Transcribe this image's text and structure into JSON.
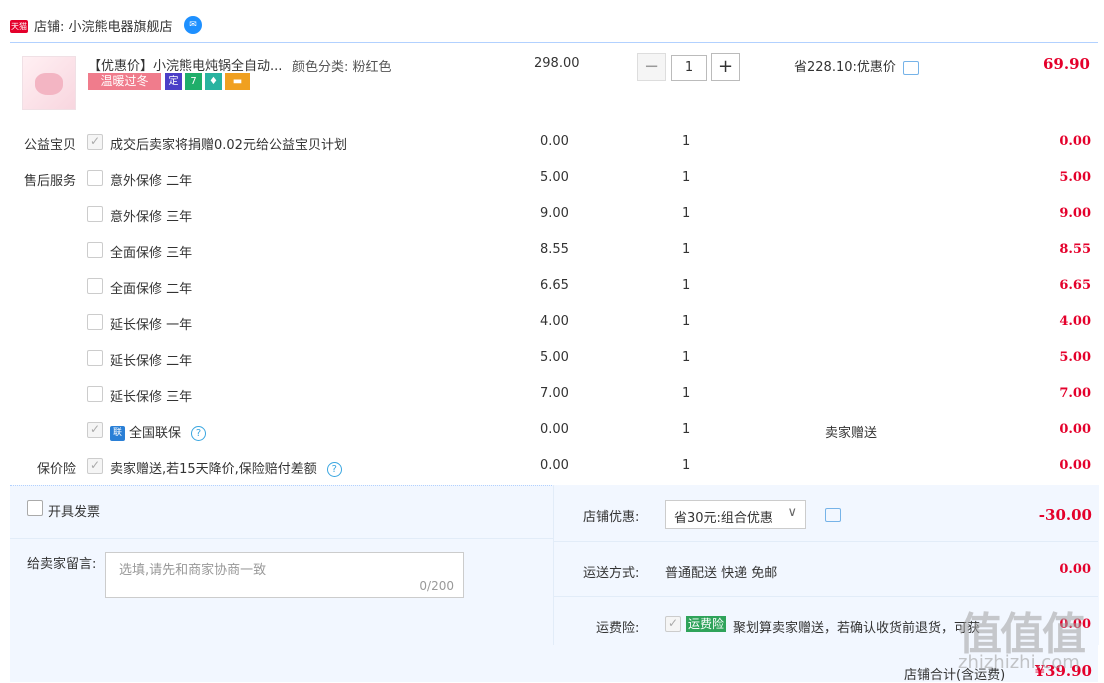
{
  "shop": {
    "badge": "天猫",
    "name": "店铺: 小浣熊电器旗舰店"
  },
  "item": {
    "title": "【优惠价】小浣熊电炖锅全自动...",
    "sku": "颜色分类: 粉红色",
    "badge_warm": "温暖过冬",
    "icons": [
      "定",
      "7",
      "♦",
      "▬"
    ],
    "unit_price": "298.00",
    "quantity": "1",
    "promo": "省228.10:优惠价",
    "total": "69.90"
  },
  "services": [
    {
      "label": "公益宝贝",
      "checked": true,
      "name": "成交后卖家将捐赠0.02元给公益宝贝计划",
      "price": "0.00",
      "qty": "1",
      "note": "",
      "total": "0.00"
    },
    {
      "label": "售后服务",
      "checked": false,
      "name": "意外保修 二年",
      "price": "5.00",
      "qty": "1",
      "note": "",
      "total": "5.00"
    },
    {
      "label": "",
      "checked": false,
      "name": "意外保修 三年",
      "price": "9.00",
      "qty": "1",
      "note": "",
      "total": "9.00"
    },
    {
      "label": "",
      "checked": false,
      "name": "全面保修 三年",
      "price": "8.55",
      "qty": "1",
      "note": "",
      "total": "8.55"
    },
    {
      "label": "",
      "checked": false,
      "name": "全面保修 二年",
      "price": "6.65",
      "qty": "1",
      "note": "",
      "total": "6.65"
    },
    {
      "label": "",
      "checked": false,
      "name": "延长保修 一年",
      "price": "4.00",
      "qty": "1",
      "note": "",
      "total": "4.00"
    },
    {
      "label": "",
      "checked": false,
      "name": "延长保修 二年",
      "price": "5.00",
      "qty": "1",
      "note": "",
      "total": "5.00"
    },
    {
      "label": "",
      "checked": false,
      "name": "延长保修 三年",
      "price": "7.00",
      "qty": "1",
      "note": "",
      "total": "7.00"
    },
    {
      "label": "",
      "checked": true,
      "name": "全国联保",
      "price": "0.00",
      "qty": "1",
      "note": "卖家赠送",
      "total": "0.00"
    },
    {
      "label": "保价险",
      "checked": true,
      "name": "卖家赠送,若15天降价,保险赔付差额",
      "price": "0.00",
      "qty": "1",
      "note": "",
      "total": "0.00"
    }
  ],
  "lian_badge": "联",
  "invoice": {
    "label": "开具发票"
  },
  "message": {
    "label": "给卖家留言:",
    "placeholder": "选填,请先和商家协商一致",
    "count": "0/200"
  },
  "discount": {
    "label": "店铺优惠:",
    "selected": "省30元:组合优惠",
    "total": "-30.00"
  },
  "shipping": {
    "label": "运送方式:",
    "value": "普通配送 快递 免邮",
    "total": "0.00"
  },
  "insurance": {
    "label": "运费险:",
    "tag": "运费险",
    "text": "聚划算卖家赠送，若确认收货前退货，可获",
    "total": "0.00"
  },
  "summary": {
    "label": "店铺合计(含运费)",
    "total": "¥39.90"
  },
  "watermark": {
    "main": "值值值",
    "sub": "zhizhizhi.com"
  },
  "colors": {
    "accent": "#e4002b",
    "link": "#3aa6e0",
    "panel": "#f2f7ff"
  }
}
